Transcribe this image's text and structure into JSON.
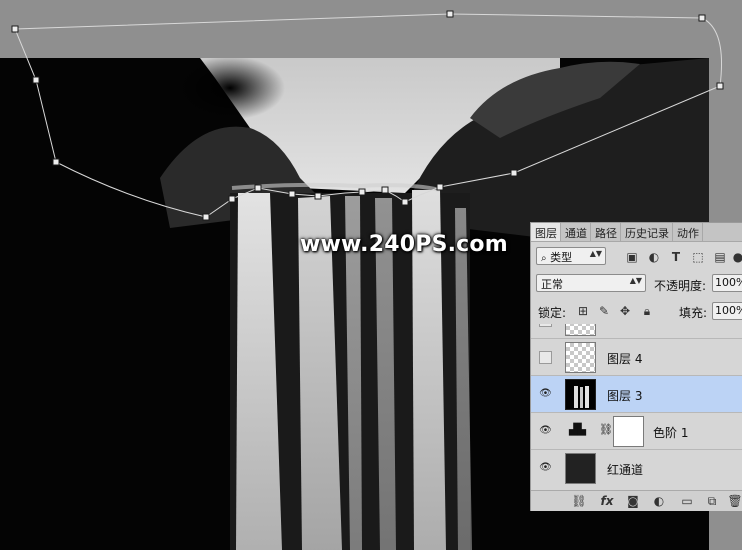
{
  "watermark": "www.240PS.com",
  "layers_panel": {
    "tabs": [
      "图层",
      "通道",
      "路径",
      "历史记录",
      "动作"
    ],
    "filter_kind": "类型",
    "blend_mode": "正常",
    "opacity_label": "不透明度:",
    "opacity_value": "100%",
    "lock_label": "锁定:",
    "fill_label": "填充:",
    "fill_value": "100%",
    "layers": [
      {
        "name": "",
        "visible": false,
        "selected": false
      },
      {
        "name": "图层 4",
        "visible": false,
        "selected": false
      },
      {
        "name": "图层 3",
        "visible": true,
        "selected": true
      },
      {
        "name": "色阶 1",
        "visible": true,
        "selected": false
      },
      {
        "name": "红通道",
        "visible": true,
        "selected": false
      }
    ]
  },
  "colors": {
    "canvas_bg": "#8f8f8f",
    "panel_bg": "#d6d6d6",
    "selected_layer": "#bcd3f5"
  }
}
